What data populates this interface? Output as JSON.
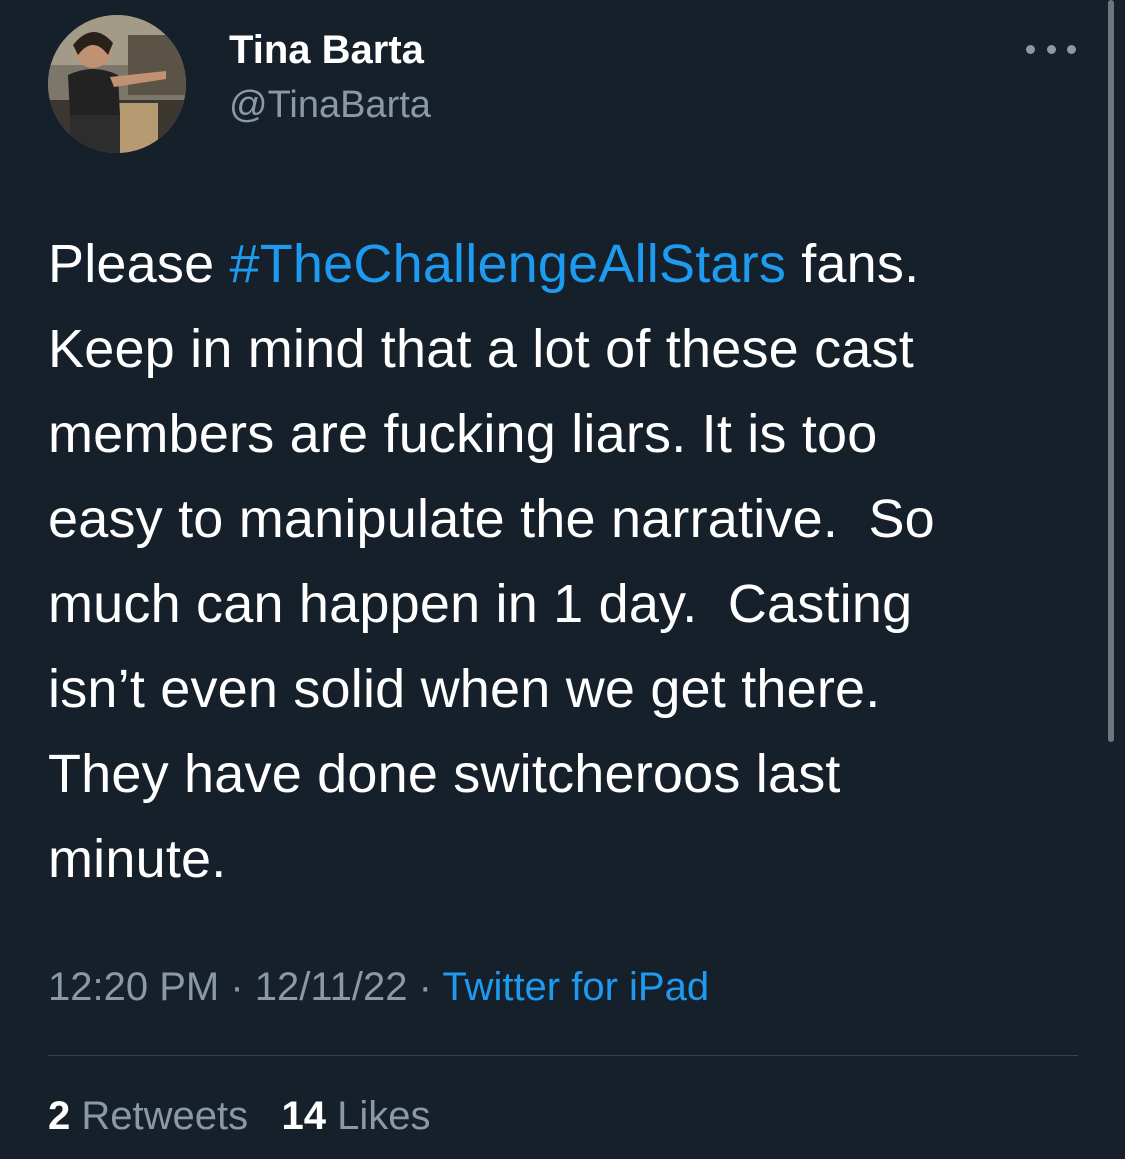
{
  "author": {
    "display_name": "Tina Barta",
    "handle": "@TinaBarta"
  },
  "tweet": {
    "lines": [
      {
        "before": "Please ",
        "hashtag": "#TheChallengeAllStars",
        "after": " fans."
      },
      "Keep in mind that a lot of these cast",
      "members are fucking liars. It is too",
      "easy to manipulate the narrative.  So",
      "much can happen in 1 day.  Casting",
      "isn’t even solid when we get there.",
      "They have done switcheroos last",
      "minute."
    ]
  },
  "meta": {
    "time": "12:20 PM",
    "separator": " · ",
    "date": "12/11/22",
    "source": "Twitter for iPad"
  },
  "stats": {
    "retweets_count": "2",
    "retweets_label": "Retweets",
    "likes_count": "14",
    "likes_label": "Likes"
  },
  "icons": {
    "more": "more-horizontal-icon",
    "avatar": "profile-photo"
  },
  "colors": {
    "background": "#15202b",
    "text": "#ffffff",
    "secondary": "#8b98a5",
    "link": "#1d9bf0",
    "divider": "#38444d"
  }
}
